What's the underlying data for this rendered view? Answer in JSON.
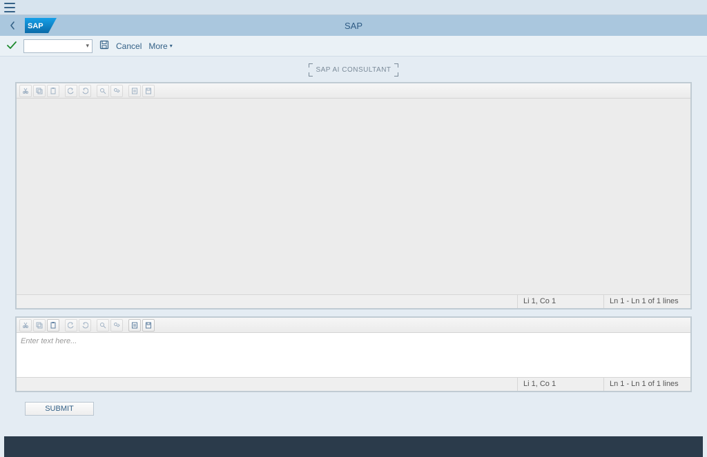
{
  "header": {
    "title": "SAP"
  },
  "toolbar": {
    "cancel_label": "Cancel",
    "more_label": "More"
  },
  "section": {
    "title": "SAP AI CONSULTANT"
  },
  "editor_top": {
    "status_pos": "Li 1, Co 1",
    "status_lines": "Ln 1 - Ln 1 of 1 lines"
  },
  "editor_bottom": {
    "placeholder": "Enter text here...",
    "status_pos": "Li 1, Co 1",
    "status_lines": "Ln 1 - Ln 1 of 1 lines"
  },
  "submit": {
    "label": "SUBMIT"
  }
}
